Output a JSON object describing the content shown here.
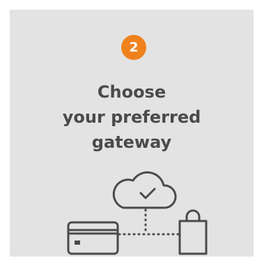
{
  "step": {
    "number": "2"
  },
  "heading": {
    "lines": [
      "Choose",
      "your preferred",
      "gateway"
    ]
  },
  "colors": {
    "badge": "#f0821e",
    "background": "#e3e3e3",
    "text": "#4a4a4a",
    "icon_stroke": "#4a4a4a"
  },
  "icons": [
    "cloud-check-icon",
    "credit-card-icon",
    "shopping-bag-icon"
  ]
}
